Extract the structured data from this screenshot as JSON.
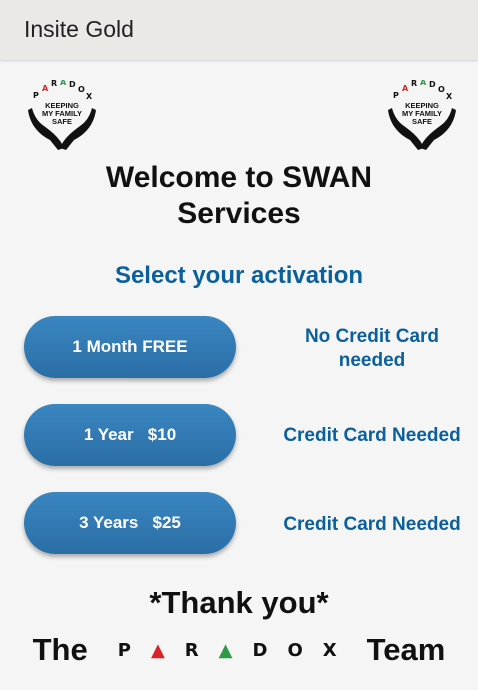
{
  "app": {
    "title": "Insite Gold"
  },
  "logo": {
    "letters": [
      "P",
      "A",
      "R",
      "A",
      "D",
      "O",
      "X"
    ],
    "line1": "KEEPING",
    "line2": "MY FAMILY",
    "line3": "SAFE"
  },
  "welcome": {
    "line1": "Welcome to SWAN",
    "line2": "Services"
  },
  "subhead": "Select your activation",
  "options": [
    {
      "button": "1 Month FREE",
      "note_line1": "No Credit Card",
      "note_line2": "needed"
    },
    {
      "button": "1 Year   $10",
      "note": "Credit Card Needed"
    },
    {
      "button": "3 Years   $25",
      "note": "Credit Card Needed"
    }
  ],
  "thanks": "*Thank you*",
  "team": {
    "prefix": "The",
    "brand": [
      "P",
      "▲",
      "R",
      "▲",
      "D",
      "O",
      "X"
    ],
    "suffix": "Team"
  },
  "colors": {
    "accent": "#0b5f9d",
    "button": "#2f78b3",
    "red": "#d8232a",
    "green": "#2e9a47"
  }
}
